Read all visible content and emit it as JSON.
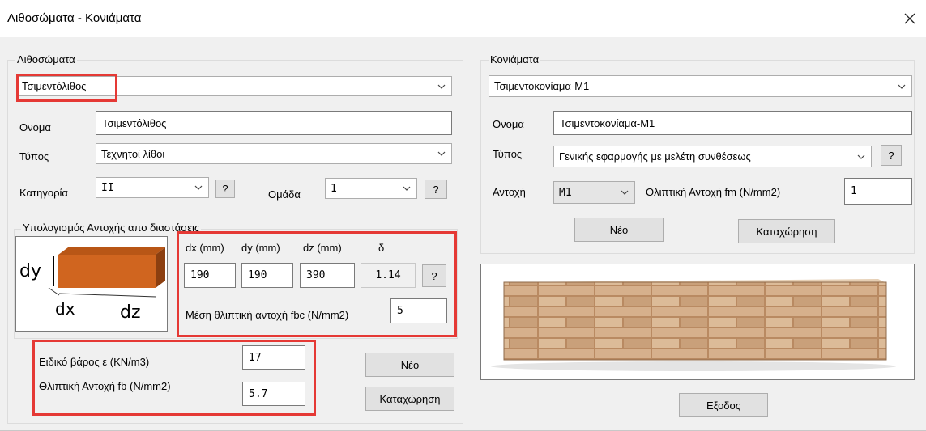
{
  "window": {
    "title": "Λιθοσώματα - Κονιάματα"
  },
  "masonry": {
    "group_label": "Λιθοσώματα",
    "selected": "Τσιμεντόλιθος",
    "name_label": "Ονομα",
    "name_value": "Τσιμεντόλιθος",
    "type_label": "Τύπος",
    "type_value": "Τεχνητοί λίθοι",
    "category_label": "Κατηγορία",
    "category_value": "II",
    "help": "?",
    "group_num_label": "Ομάδα",
    "group_num_value": "1"
  },
  "calc": {
    "group_label": "Υπολογισμός Αντοχής απο διαστάσεις",
    "diagram": {
      "dy": "dy",
      "dx": "dx",
      "dz": "dz"
    },
    "headers": {
      "dx": "dx (mm)",
      "dy": "dy (mm)",
      "dz": "dz (mm)",
      "delta": "δ"
    },
    "values": {
      "dx": "190",
      "dy": "190",
      "dz": "390",
      "delta": "1.14"
    },
    "help": "?",
    "fbc_label": "Μέση θλιπτική αντοχή fbc (N/mm2)",
    "fbc_value": "5"
  },
  "props": {
    "weight_label": "Ειδικό βάρος ε (KN/m3)",
    "weight_value": "17",
    "fb_label": "Θλιπτική Αντοχή fb (N/mm2)",
    "fb_value": "5.7",
    "new_label": "Νέο",
    "save_label": "Καταχώρηση"
  },
  "mortar": {
    "group_label": "Κονιάματα",
    "selected": "Τσιμεντοκονίαμα-M1",
    "name_label": "Ονομα",
    "name_value": "Τσιμεντοκονίαμα-M1",
    "type_label": "Τύπος",
    "type_value": "Γενικής εφαρμογής με μελέτη συνθέσεως",
    "help": "?",
    "strength_label": "Αντοχή",
    "strength_value": "M1",
    "fm_label": "Θλιπτική Αντοχή fm (N/mm2)",
    "fm_value": "1",
    "new_label": "Νέο",
    "save_label": "Καταχώρηση"
  },
  "footer": {
    "exit_label": "Εξοδος"
  },
  "colors": {
    "highlight": "#e53935",
    "brick": "#d0651f",
    "wall": "#c8a07a"
  }
}
